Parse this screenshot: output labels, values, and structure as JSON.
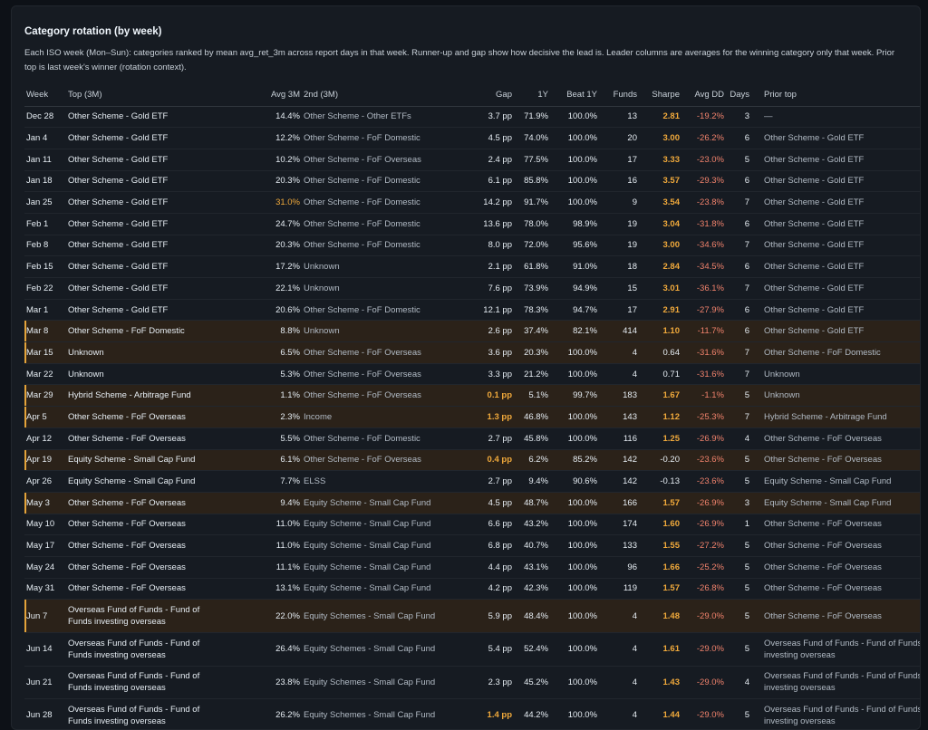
{
  "title": "Category rotation (by week)",
  "description": "Each ISO week (Mon–Sun): categories ranked by mean avg_ret_3m across report days in that week. Runner-up and gap show how decisive the lead is. Leader columns are averages for the winning category only that week. Prior top is last week's winner (rotation context).",
  "colors": {
    "background": "#0d1117",
    "panel": "#161b22",
    "highlight_row": "#2b2219",
    "accent": "#f0a93b",
    "drawdown": "#f0826c"
  },
  "columns": [
    "Week",
    "Top (3M)",
    "Avg 3M",
    "2nd (3M)",
    "Gap",
    "1Y",
    "Beat 1Y",
    "Funds",
    "Sharpe",
    "Avg DD",
    "Days",
    "Prior top"
  ],
  "rows": [
    {
      "week": "Dec 28",
      "top": "Other Scheme - Gold ETF",
      "avg3m": "14.4%",
      "second": "Other Scheme - Other ETFs",
      "gap": "3.7 pp",
      "y1": "71.9%",
      "beat": "100.0%",
      "funds": "13",
      "sharpe": "2.81",
      "dd": "-19.2%",
      "days": "3",
      "prior": "—",
      "highlight": false,
      "avg_hl": false,
      "gap_hl": false,
      "sharpe_hl": true
    },
    {
      "week": "Jan 4",
      "top": "Other Scheme - Gold ETF",
      "avg3m": "12.2%",
      "second": "Other Scheme - FoF Domestic",
      "gap": "4.5 pp",
      "y1": "74.0%",
      "beat": "100.0%",
      "funds": "20",
      "sharpe": "3.00",
      "dd": "-26.2%",
      "days": "6",
      "prior": "Other Scheme - Gold ETF",
      "highlight": false,
      "avg_hl": false,
      "gap_hl": false,
      "sharpe_hl": true
    },
    {
      "week": "Jan 11",
      "top": "Other Scheme - Gold ETF",
      "avg3m": "10.2%",
      "second": "Other Scheme - FoF Overseas",
      "gap": "2.4 pp",
      "y1": "77.5%",
      "beat": "100.0%",
      "funds": "17",
      "sharpe": "3.33",
      "dd": "-23.0%",
      "days": "5",
      "prior": "Other Scheme - Gold ETF",
      "highlight": false,
      "avg_hl": false,
      "gap_hl": false,
      "sharpe_hl": true
    },
    {
      "week": "Jan 18",
      "top": "Other Scheme - Gold ETF",
      "avg3m": "20.3%",
      "second": "Other Scheme - FoF Domestic",
      "gap": "6.1 pp",
      "y1": "85.8%",
      "beat": "100.0%",
      "funds": "16",
      "sharpe": "3.57",
      "dd": "-29.3%",
      "days": "6",
      "prior": "Other Scheme - Gold ETF",
      "highlight": false,
      "avg_hl": false,
      "gap_hl": false,
      "sharpe_hl": true
    },
    {
      "week": "Jan 25",
      "top": "Other Scheme - Gold ETF",
      "avg3m": "31.0%",
      "second": "Other Scheme - FoF Domestic",
      "gap": "14.2 pp",
      "y1": "91.7%",
      "beat": "100.0%",
      "funds": "9",
      "sharpe": "3.54",
      "dd": "-23.8%",
      "days": "7",
      "prior": "Other Scheme - Gold ETF",
      "highlight": false,
      "avg_hl": true,
      "gap_hl": false,
      "sharpe_hl": true
    },
    {
      "week": "Feb 1",
      "top": "Other Scheme - Gold ETF",
      "avg3m": "24.7%",
      "second": "Other Scheme - FoF Domestic",
      "gap": "13.6 pp",
      "y1": "78.0%",
      "beat": "98.9%",
      "funds": "19",
      "sharpe": "3.04",
      "dd": "-31.8%",
      "days": "6",
      "prior": "Other Scheme - Gold ETF",
      "highlight": false,
      "avg_hl": false,
      "gap_hl": false,
      "sharpe_hl": true
    },
    {
      "week": "Feb 8",
      "top": "Other Scheme - Gold ETF",
      "avg3m": "20.3%",
      "second": "Other Scheme - FoF Domestic",
      "gap": "8.0 pp",
      "y1": "72.0%",
      "beat": "95.6%",
      "funds": "19",
      "sharpe": "3.00",
      "dd": "-34.6%",
      "days": "7",
      "prior": "Other Scheme - Gold ETF",
      "highlight": false,
      "avg_hl": false,
      "gap_hl": false,
      "sharpe_hl": true
    },
    {
      "week": "Feb 15",
      "top": "Other Scheme - Gold ETF",
      "avg3m": "17.2%",
      "second": "Unknown",
      "gap": "2.1 pp",
      "y1": "61.8%",
      "beat": "91.0%",
      "funds": "18",
      "sharpe": "2.84",
      "dd": "-34.5%",
      "days": "6",
      "prior": "Other Scheme - Gold ETF",
      "highlight": false,
      "avg_hl": false,
      "gap_hl": false,
      "sharpe_hl": true
    },
    {
      "week": "Feb 22",
      "top": "Other Scheme - Gold ETF",
      "avg3m": "22.1%",
      "second": "Unknown",
      "gap": "7.6 pp",
      "y1": "73.9%",
      "beat": "94.9%",
      "funds": "15",
      "sharpe": "3.01",
      "dd": "-36.1%",
      "days": "7",
      "prior": "Other Scheme - Gold ETF",
      "highlight": false,
      "avg_hl": false,
      "gap_hl": false,
      "sharpe_hl": true
    },
    {
      "week": "Mar 1",
      "top": "Other Scheme - Gold ETF",
      "avg3m": "20.6%",
      "second": "Other Scheme - FoF Domestic",
      "gap": "12.1 pp",
      "y1": "78.3%",
      "beat": "94.7%",
      "funds": "17",
      "sharpe": "2.91",
      "dd": "-27.9%",
      "days": "6",
      "prior": "Other Scheme - Gold ETF",
      "highlight": false,
      "avg_hl": false,
      "gap_hl": false,
      "sharpe_hl": true
    },
    {
      "week": "Mar 8",
      "top": "Other Scheme - FoF Domestic",
      "avg3m": "8.8%",
      "second": "Unknown",
      "gap": "2.6 pp",
      "y1": "37.4%",
      "beat": "82.1%",
      "funds": "414",
      "sharpe": "1.10",
      "dd": "-11.7%",
      "days": "6",
      "prior": "Other Scheme - Gold ETF",
      "highlight": true,
      "avg_hl": false,
      "gap_hl": false,
      "sharpe_hl": true
    },
    {
      "week": "Mar 15",
      "top": "Unknown",
      "avg3m": "6.5%",
      "second": "Other Scheme - FoF Overseas",
      "gap": "3.6 pp",
      "y1": "20.3%",
      "beat": "100.0%",
      "funds": "4",
      "sharpe": "0.64",
      "dd": "-31.6%",
      "days": "7",
      "prior": "Other Scheme - FoF Domestic",
      "highlight": true,
      "avg_hl": false,
      "gap_hl": false,
      "sharpe_hl": false
    },
    {
      "week": "Mar 22",
      "top": "Unknown",
      "avg3m": "5.3%",
      "second": "Other Scheme - FoF Overseas",
      "gap": "3.3 pp",
      "y1": "21.2%",
      "beat": "100.0%",
      "funds": "4",
      "sharpe": "0.71",
      "dd": "-31.6%",
      "days": "7",
      "prior": "Unknown",
      "highlight": false,
      "avg_hl": false,
      "gap_hl": false,
      "sharpe_hl": false
    },
    {
      "week": "Mar 29",
      "top": "Hybrid Scheme - Arbitrage Fund",
      "avg3m": "1.1%",
      "second": "Other Scheme - FoF Overseas",
      "gap": "0.1 pp",
      "y1": "5.1%",
      "beat": "99.7%",
      "funds": "183",
      "sharpe": "1.67",
      "dd": "-1.1%",
      "days": "5",
      "prior": "Unknown",
      "highlight": true,
      "avg_hl": false,
      "gap_hl": true,
      "sharpe_hl": true
    },
    {
      "week": "Apr 5",
      "top": "Other Scheme - FoF Overseas",
      "avg3m": "2.3%",
      "second": "Income",
      "gap": "1.3 pp",
      "y1": "46.8%",
      "beat": "100.0%",
      "funds": "143",
      "sharpe": "1.12",
      "dd": "-25.3%",
      "days": "7",
      "prior": "Hybrid Scheme - Arbitrage Fund",
      "highlight": true,
      "avg_hl": false,
      "gap_hl": true,
      "sharpe_hl": true
    },
    {
      "week": "Apr 12",
      "top": "Other Scheme - FoF Overseas",
      "avg3m": "5.5%",
      "second": "Other Scheme - FoF Domestic",
      "gap": "2.7 pp",
      "y1": "45.8%",
      "beat": "100.0%",
      "funds": "116",
      "sharpe": "1.25",
      "dd": "-26.9%",
      "days": "4",
      "prior": "Other Scheme - FoF Overseas",
      "highlight": false,
      "avg_hl": false,
      "gap_hl": false,
      "sharpe_hl": true
    },
    {
      "week": "Apr 19",
      "top": "Equity Scheme - Small Cap Fund",
      "avg3m": "6.1%",
      "second": "Other Scheme - FoF Overseas",
      "gap": "0.4 pp",
      "y1": "6.2%",
      "beat": "85.2%",
      "funds": "142",
      "sharpe": "-0.20",
      "dd": "-23.6%",
      "days": "5",
      "prior": "Other Scheme - FoF Overseas",
      "highlight": true,
      "avg_hl": false,
      "gap_hl": true,
      "sharpe_hl": false
    },
    {
      "week": "Apr 26",
      "top": "Equity Scheme - Small Cap Fund",
      "avg3m": "7.7%",
      "second": "ELSS",
      "gap": "2.7 pp",
      "y1": "9.4%",
      "beat": "90.6%",
      "funds": "142",
      "sharpe": "-0.13",
      "dd": "-23.6%",
      "days": "5",
      "prior": "Equity Scheme - Small Cap Fund",
      "highlight": false,
      "avg_hl": false,
      "gap_hl": false,
      "sharpe_hl": false
    },
    {
      "week": "May 3",
      "top": "Other Scheme - FoF Overseas",
      "avg3m": "9.4%",
      "second": "Equity Scheme - Small Cap Fund",
      "gap": "4.5 pp",
      "y1": "48.7%",
      "beat": "100.0%",
      "funds": "166",
      "sharpe": "1.57",
      "dd": "-26.9%",
      "days": "3",
      "prior": "Equity Scheme - Small Cap Fund",
      "highlight": true,
      "avg_hl": false,
      "gap_hl": false,
      "sharpe_hl": true
    },
    {
      "week": "May 10",
      "top": "Other Scheme - FoF Overseas",
      "avg3m": "11.0%",
      "second": "Equity Scheme - Small Cap Fund",
      "gap": "6.6 pp",
      "y1": "43.2%",
      "beat": "100.0%",
      "funds": "174",
      "sharpe": "1.60",
      "dd": "-26.9%",
      "days": "1",
      "prior": "Other Scheme - FoF Overseas",
      "highlight": false,
      "avg_hl": false,
      "gap_hl": false,
      "sharpe_hl": true
    },
    {
      "week": "May 17",
      "top": "Other Scheme - FoF Overseas",
      "avg3m": "11.0%",
      "second": "Equity Scheme - Small Cap Fund",
      "gap": "6.8 pp",
      "y1": "40.7%",
      "beat": "100.0%",
      "funds": "133",
      "sharpe": "1.55",
      "dd": "-27.2%",
      "days": "5",
      "prior": "Other Scheme - FoF Overseas",
      "highlight": false,
      "avg_hl": false,
      "gap_hl": false,
      "sharpe_hl": true
    },
    {
      "week": "May 24",
      "top": "Other Scheme - FoF Overseas",
      "avg3m": "11.1%",
      "second": "Equity Scheme - Small Cap Fund",
      "gap": "4.4 pp",
      "y1": "43.1%",
      "beat": "100.0%",
      "funds": "96",
      "sharpe": "1.66",
      "dd": "-25.2%",
      "days": "5",
      "prior": "Other Scheme - FoF Overseas",
      "highlight": false,
      "avg_hl": false,
      "gap_hl": false,
      "sharpe_hl": true
    },
    {
      "week": "May 31",
      "top": "Other Scheme - FoF Overseas",
      "avg3m": "13.1%",
      "second": "Equity Scheme - Small Cap Fund",
      "gap": "4.2 pp",
      "y1": "42.3%",
      "beat": "100.0%",
      "funds": "119",
      "sharpe": "1.57",
      "dd": "-26.8%",
      "days": "5",
      "prior": "Other Scheme - FoF Overseas",
      "highlight": false,
      "avg_hl": false,
      "gap_hl": false,
      "sharpe_hl": true
    },
    {
      "week": "Jun 7",
      "top": "Overseas Fund of Funds - Fund of Funds investing overseas",
      "avg3m": "22.0%",
      "second": "Equity Schemes - Small Cap Fund",
      "gap": "5.9 pp",
      "y1": "48.4%",
      "beat": "100.0%",
      "funds": "4",
      "sharpe": "1.48",
      "dd": "-29.0%",
      "days": "5",
      "prior": "Other Scheme - FoF Overseas",
      "highlight": true,
      "avg_hl": false,
      "gap_hl": false,
      "sharpe_hl": true
    },
    {
      "week": "Jun 14",
      "top": "Overseas Fund of Funds - Fund of Funds investing overseas",
      "avg3m": "26.4%",
      "second": "Equity Schemes - Small Cap Fund",
      "gap": "5.4 pp",
      "y1": "52.4%",
      "beat": "100.0%",
      "funds": "4",
      "sharpe": "1.61",
      "dd": "-29.0%",
      "days": "5",
      "prior": "Overseas Fund of Funds - Fund of Funds investing overseas",
      "highlight": false,
      "avg_hl": false,
      "gap_hl": false,
      "sharpe_hl": true
    },
    {
      "week": "Jun 21",
      "top": "Overseas Fund of Funds - Fund of Funds investing overseas",
      "avg3m": "23.8%",
      "second": "Equity Schemes - Small Cap Fund",
      "gap": "2.3 pp",
      "y1": "45.2%",
      "beat": "100.0%",
      "funds": "4",
      "sharpe": "1.43",
      "dd": "-29.0%",
      "days": "4",
      "prior": "Overseas Fund of Funds - Fund of Funds investing overseas",
      "highlight": false,
      "avg_hl": false,
      "gap_hl": false,
      "sharpe_hl": true
    },
    {
      "week": "Jun 28",
      "top": "Overseas Fund of Funds - Fund of Funds investing overseas",
      "avg3m": "26.2%",
      "second": "Equity Schemes - Small Cap Fund",
      "gap": "1.4 pp",
      "y1": "44.2%",
      "beat": "100.0%",
      "funds": "4",
      "sharpe": "1.44",
      "dd": "-29.0%",
      "days": "5",
      "prior": "Overseas Fund of Funds - Fund of Funds investing overseas",
      "highlight": false,
      "avg_hl": false,
      "gap_hl": true,
      "sharpe_hl": true
    }
  ]
}
